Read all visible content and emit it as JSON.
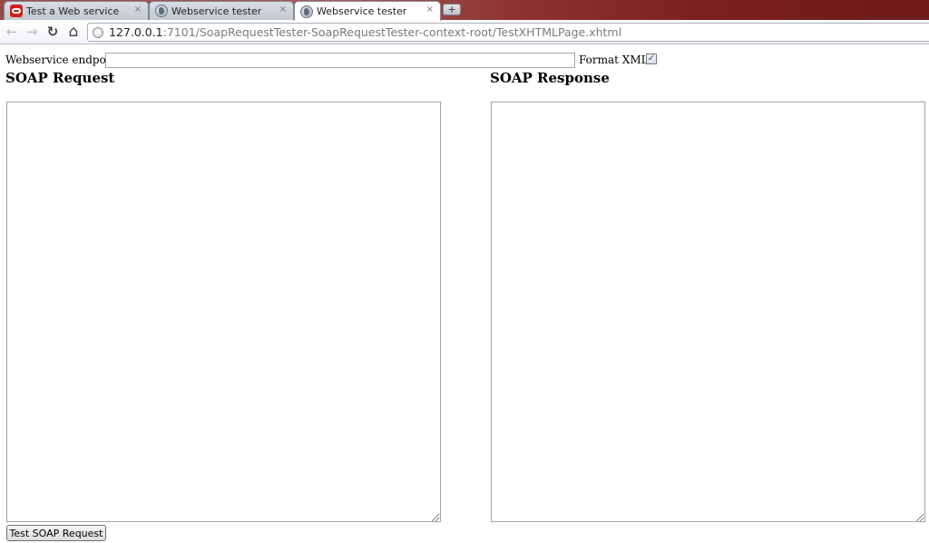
{
  "browser": {
    "tabs": [
      {
        "title": "Test a Web service",
        "icon": "oracle-icon",
        "active": false
      },
      {
        "title": "Webservice tester",
        "icon": "globe-icon",
        "active": false
      },
      {
        "title": "Webservice tester",
        "icon": "globe-icon",
        "active": true
      }
    ],
    "tab_close_glyph": "×",
    "new_tab_glyph": "+",
    "nav": {
      "back_glyph": "←",
      "forward_glyph": "→",
      "reload_glyph": "↻",
      "home_glyph": "⌂"
    },
    "url": {
      "host": "127.0.0.1",
      "rest": ":7101/SoapRequestTester-SoapRequestTester-context-root/TestXHTMLPage.xhtml"
    }
  },
  "form": {
    "endpoint_label": "Webservice endpoint",
    "endpoint_value": "",
    "format_label": "Format XML",
    "format_checked": true,
    "format_check_glyph": "✓",
    "request_title": "SOAP Request",
    "request_value": "",
    "response_title": "SOAP Response",
    "response_value": "",
    "submit_label": "Test SOAP Request"
  }
}
